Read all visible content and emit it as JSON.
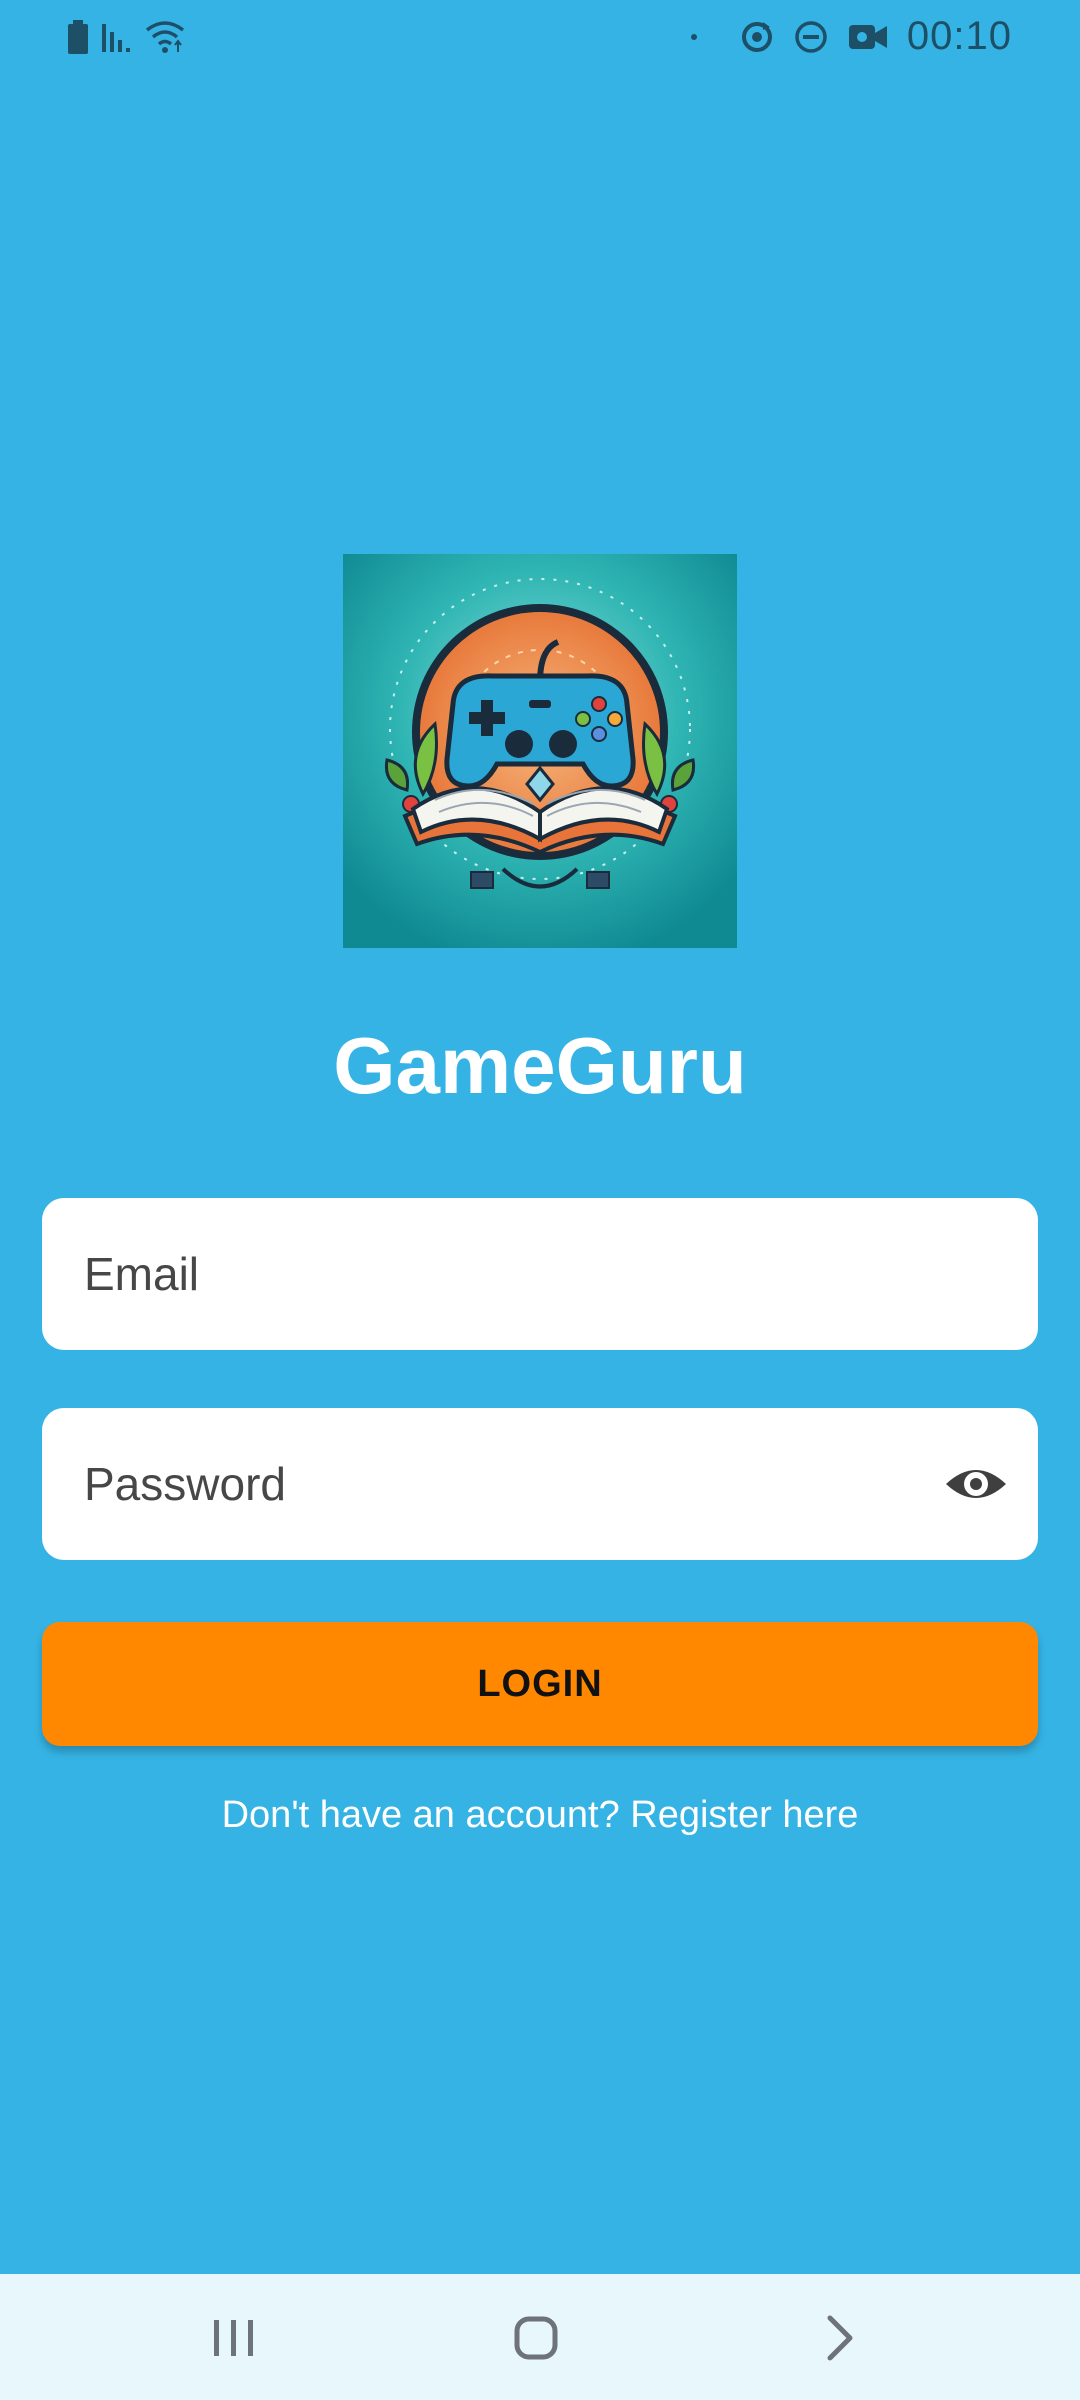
{
  "status_bar": {
    "time": "00:10",
    "left_icons": [
      "battery-icon",
      "signal-icon",
      "wifi-icon"
    ],
    "right_icons": [
      "dot-icon",
      "sync-icon",
      "do-not-disturb-icon",
      "video-camera-icon"
    ]
  },
  "app": {
    "title": "GameGuru",
    "logo": "gameguru-logo-controller-book"
  },
  "login_form": {
    "email_placeholder": "Email",
    "password_placeholder": "Password",
    "login_label": "LOGIN",
    "register_text": "Don't have an account? Register here"
  },
  "navigation": {
    "icons": [
      "recent-apps-icon",
      "home-icon",
      "back-icon"
    ]
  },
  "colors": {
    "background": "#35b3e5",
    "button": "#ff8800",
    "field": "#ffffff",
    "nav_bar": "#e8f7fc"
  }
}
